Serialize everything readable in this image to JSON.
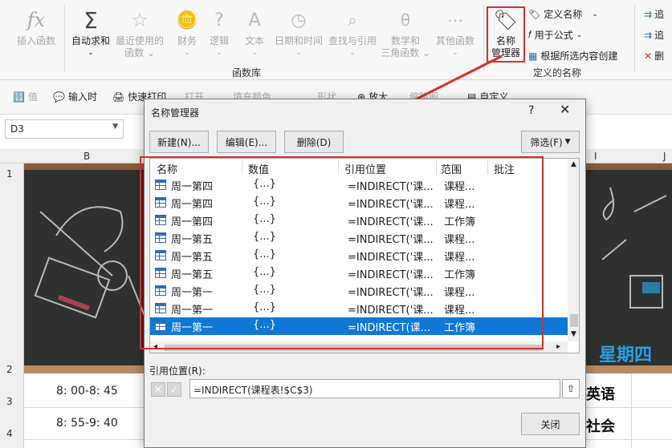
{
  "ribbon": {
    "buttons": [
      {
        "label": "插入函数",
        "active": false
      },
      {
        "label": "自动求和",
        "active": true
      },
      {
        "label": "最近使用的",
        "sub": "函数 ⌄",
        "active": false
      },
      {
        "label": "财务",
        "sub": "⌄",
        "active": false
      },
      {
        "label": "逻辑",
        "sub": "⌄",
        "active": false
      },
      {
        "label": "文本",
        "sub": "⌄",
        "active": false
      },
      {
        "label": "日期和时间",
        "sub": "⌄",
        "active": false
      },
      {
        "label": "查找与引用",
        "sub": "⌄",
        "active": false
      },
      {
        "label": "数学和",
        "sub": "三角函数 ⌄",
        "active": false
      },
      {
        "label": "其他函数",
        "sub": "⌄",
        "active": false
      }
    ],
    "name_manager": {
      "line1": "名称",
      "line2": "管理器"
    },
    "define_name": "定义名称",
    "use_in_formula": "用于公式",
    "create_from_selection": "根据所选内容创建",
    "group_library": "函数库",
    "group_defined": "定义的名称",
    "right_items": [
      "追",
      "追",
      "删"
    ]
  },
  "quickbar": {
    "items": [
      "值",
      "输入时",
      "快速打印",
      "打开",
      "填充颜色",
      "形状",
      "放大",
      "缩略图",
      "自定义"
    ]
  },
  "formula_bar": {
    "cell_ref": "D3"
  },
  "sheet": {
    "columns": [
      "B",
      "I",
      "J"
    ],
    "rows": [
      "1",
      "2",
      "3",
      "4"
    ],
    "weekday": "星期四",
    "times": [
      "8: 00-8: 45",
      "8: 55-9: 40"
    ],
    "subjects": [
      "英语",
      "社会"
    ]
  },
  "dialog": {
    "title": "名称管理器",
    "help": "?",
    "close": "✕",
    "new_btn": "新建(N)...",
    "edit_btn": "编辑(E)...",
    "delete_btn": "删除(D)",
    "filter_btn": "筛选(F)",
    "headers": {
      "name": "名称",
      "value": "数值",
      "ref": "引用位置",
      "scope": "范围",
      "comment": "批注"
    },
    "rows": [
      {
        "name": "周一第四",
        "value": "{...}",
        "ref": "=INDIRECT('课...",
        "scope": "课程..."
      },
      {
        "name": "周一第四",
        "value": "{...}",
        "ref": "=INDIRECT('课...",
        "scope": "课程..."
      },
      {
        "name": "周一第四",
        "value": "{...}",
        "ref": "=INDIRECT('课...",
        "scope": "工作簿"
      },
      {
        "name": "周一第五",
        "value": "{...}",
        "ref": "=INDIRECT('课...",
        "scope": "课程..."
      },
      {
        "name": "周一第五",
        "value": "{...}",
        "ref": "=INDIRECT('课...",
        "scope": "课程..."
      },
      {
        "name": "周一第五",
        "value": "{...}",
        "ref": "=INDIRECT('课...",
        "scope": "工作簿"
      },
      {
        "name": "周一第一",
        "value": "{...}",
        "ref": "=INDIRECT('课...",
        "scope": "课程..."
      },
      {
        "name": "周一第一",
        "value": "{...}",
        "ref": "=INDIRECT('课...",
        "scope": "课程..."
      },
      {
        "name": "周一第一",
        "value": "{...}",
        "ref": "=INDIRECT(课...",
        "scope": "工作簿",
        "selected": true
      }
    ],
    "ref_label": "引用位置(R):",
    "ref_value": "=INDIRECT(课程表!$C$3)",
    "close_btn": "关闭"
  },
  "colors": {
    "highlight": "#d7302b",
    "selection": "#0f78d7",
    "weekday": "#27a0e4"
  }
}
